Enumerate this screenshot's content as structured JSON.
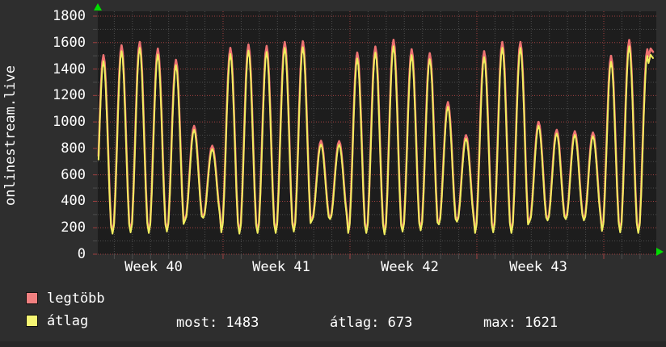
{
  "axis_title": "onlinestream.live",
  "colors": {
    "background": "#2e2e2e",
    "plot_background": "#1d1d1d",
    "major_grid": "#a04040",
    "minor_grid": "#4d4d4d",
    "max_line": "#ee7272",
    "avg_line": "#f0ee5e",
    "legend_max_swatch": "#f08080",
    "legend_avg_swatch": "#f5f573",
    "arrow": "#00dd00",
    "text": "#ffffff"
  },
  "chart_data": {
    "type": "line",
    "title": "onlinestream.live",
    "ylabel": "onlinestream.live",
    "ylim": [
      0,
      1800
    ],
    "y_ticks": [
      1800,
      1600,
      1400,
      1200,
      1000,
      800,
      600,
      400,
      200,
      0
    ],
    "x_tick_labels": [
      "Week 40",
      "Week 41",
      "Week 42",
      "Week 43"
    ],
    "grid": "dotted; minor every 100 (y) and 1 day (x); major red every 200 (y) and 1 week (x)",
    "legend_position": "bottom-left",
    "days_shown": 31,
    "series": [
      {
        "name": "legtöbb",
        "role": "daily maximum",
        "daily_peaks": [
          1505,
          1580,
          1605,
          1555,
          1470,
          970,
          820,
          1560,
          1585,
          1575,
          1605,
          1610,
          857,
          855,
          1525,
          1570,
          1621,
          1550,
          1520,
          1150,
          900,
          1535,
          1605,
          1605,
          1000,
          940,
          930,
          920,
          1500,
          1620,
          1550
        ],
        "end_value": 1530
      },
      {
        "name": "átlag",
        "role": "average",
        "daily_peaks": [
          1460,
          1535,
          1560,
          1510,
          1430,
          940,
          795,
          1515,
          1540,
          1530,
          1560,
          1565,
          830,
          828,
          1480,
          1525,
          1573,
          1505,
          1475,
          1115,
          873,
          1490,
          1560,
          1560,
          970,
          912,
          902,
          892,
          1455,
          1572,
          1500
        ],
        "end_value": 1483
      }
    ],
    "daily_troughs": [
      150,
      155,
      165,
      160,
      170,
      255,
      275,
      165,
      155,
      160,
      160,
      170,
      255,
      265,
      160,
      160,
      150,
      170,
      180,
      225,
      245,
      160,
      165,
      160,
      245,
      255,
      265,
      255,
      175,
      165,
      160
    ]
  },
  "legend": {
    "items": [
      {
        "label": "legtöbb",
        "color": "#f08080"
      },
      {
        "label": "átlag",
        "color": "#f5f573"
      }
    ]
  },
  "stats": [
    {
      "label": "most",
      "value": "1483"
    },
    {
      "label": "átlag",
      "value": "673"
    },
    {
      "label": "max",
      "value": "1621"
    }
  ]
}
